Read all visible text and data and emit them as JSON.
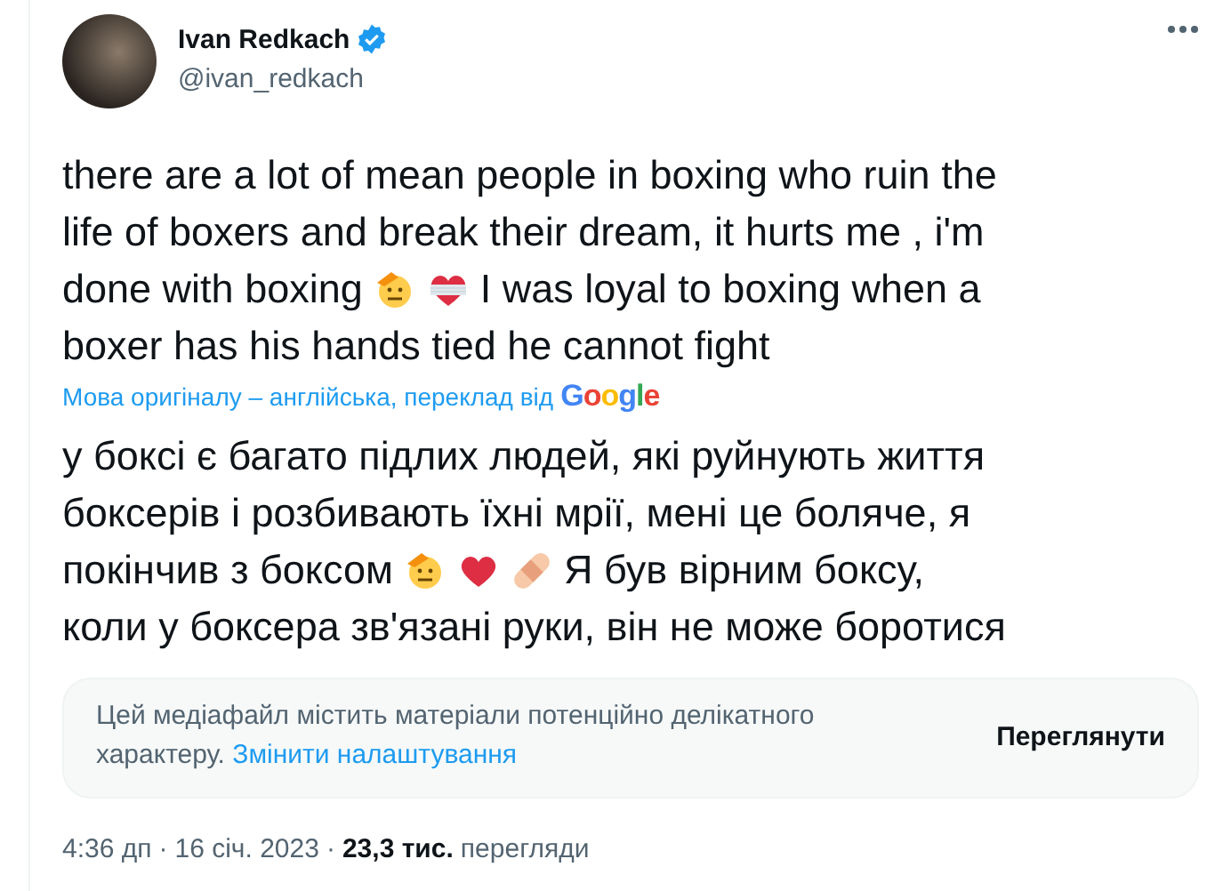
{
  "author": {
    "name": "Ivan Redkach",
    "verified": true,
    "handle": "@ivan_redkach"
  },
  "tweet_text": [
    [
      {
        "kind": "text",
        "text": "there are a lot of mean people in boxing who ruin the"
      }
    ],
    [
      {
        "kind": "text",
        "text": "life of boxers and break their dream, it hurts me , i'm"
      }
    ],
    [
      {
        "kind": "text",
        "text": "done with boxing"
      },
      {
        "kind": "saluting-face"
      },
      {
        "kind": "mending-heart"
      },
      {
        "kind": "text",
        "text": "I was loyal to boxing when a"
      }
    ],
    [
      {
        "kind": "text",
        "text": "boxer has his hands tied he cannot fight"
      }
    ]
  ],
  "translation_note": {
    "text": "Мова оригіналу – англійська, переклад від",
    "provider": "Google"
  },
  "translated_text": [
    [
      {
        "kind": "text",
        "text": "у боксі є багато підлих людей, які руйнують життя"
      }
    ],
    [
      {
        "kind": "text",
        "text": "боксерів і розбивають їхні мрії, мені це боляче, я"
      }
    ],
    [
      {
        "kind": "text",
        "text": "покінчив з боксом"
      },
      {
        "kind": "saluting-face"
      },
      {
        "kind": "red-heart"
      },
      {
        "kind": "bandage"
      },
      {
        "kind": "text",
        "text": "Я був вірним боксу,"
      }
    ],
    [
      {
        "kind": "text",
        "text": "коли у боксера зв'язані руки, він не може боротися"
      }
    ]
  ],
  "sensitive_media": {
    "message": "Цей медіафайл містить матеріали потенційно делікатного характеру.",
    "settings_link": "Змінити налаштування",
    "view_button": "Переглянути"
  },
  "footer": {
    "time": "4:36 дп",
    "separator_1": "·",
    "date": "16 січ. 2023",
    "separator_2": "·",
    "views_count": "23,3 тис.",
    "views_label": "перегляди"
  }
}
